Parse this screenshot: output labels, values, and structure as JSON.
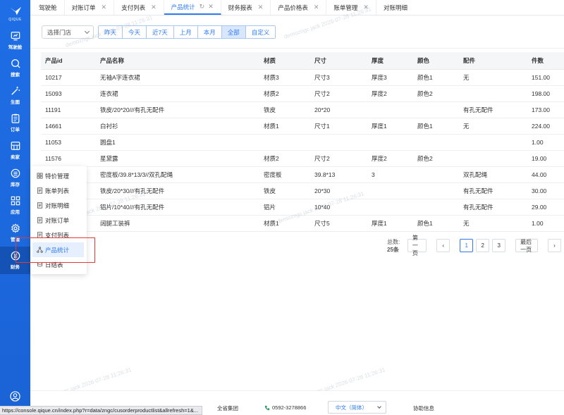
{
  "sidebar": {
    "logo_text": "QIQUE",
    "items": [
      {
        "label": "驾驶舱",
        "icon": "dashboard-icon"
      },
      {
        "label": "搜索",
        "icon": "search-icon"
      },
      {
        "label": "生图",
        "icon": "magic-wand-icon"
      },
      {
        "label": "订单",
        "icon": "order-icon"
      },
      {
        "label": "卖家",
        "icon": "seller-icon"
      },
      {
        "label": "库存",
        "icon": "inventory-icon"
      },
      {
        "label": "应用",
        "icon": "apps-icon"
      },
      {
        "label": "管理",
        "icon": "gear-icon"
      },
      {
        "label": "财务",
        "icon": "finance-icon"
      }
    ]
  },
  "tabs": [
    {
      "label": "驾驶舱",
      "closable": false
    },
    {
      "label": "对账订单",
      "closable": true
    },
    {
      "label": "支付列表",
      "closable": true
    },
    {
      "label": "产品统计",
      "closable": true,
      "active": true
    },
    {
      "label": "财务报表",
      "closable": true
    },
    {
      "label": "产品价格表",
      "closable": true
    },
    {
      "label": "账单管理",
      "closable": true
    },
    {
      "label": "对账明细",
      "closable": false
    }
  ],
  "filter": {
    "store_placeholder": "选择门店",
    "ranges": [
      "昨天",
      "今天",
      "近7天",
      "上月",
      "本月",
      "全部",
      "自定义"
    ],
    "active_range": "全部"
  },
  "table": {
    "columns": [
      "产品id",
      "产品名称",
      "材质",
      "尺寸",
      "厚度",
      "颜色",
      "配件",
      "件数"
    ],
    "rows": [
      [
        "10217",
        "无袖A字连衣裙",
        "材质3",
        "尺寸3",
        "厚度3",
        "颜色1",
        "无",
        "151.00"
      ],
      [
        "15093",
        "连衣裙",
        "材质2",
        "尺寸2",
        "厚度2",
        "颜色2",
        "",
        "198.00"
      ],
      [
        "11191",
        "铁皮/20*20///有孔无配件",
        "铁皮",
        "20*20",
        "",
        "",
        "有孔无配件",
        "173.00"
      ],
      [
        "14661",
        "白衬衫",
        "材质1",
        "尺寸1",
        "厚度1",
        "颜色1",
        "无",
        "224.00"
      ],
      [
        "11053",
        "圆盘1",
        "",
        "",
        "",
        "",
        "",
        "1.00"
      ],
      [
        "11576",
        "星黛露",
        "材质2",
        "尺寸2",
        "厚度2",
        "颜色2",
        "",
        "19.00"
      ],
      [
        "",
        "密度板/39.8*13/3//双孔配绳",
        "密度板",
        "39.8*13",
        "3",
        "",
        "双孔配绳",
        "44.00"
      ],
      [
        "",
        "铁皮/20*30///有孔无配件",
        "铁皮",
        "20*30",
        "",
        "",
        "有孔无配件",
        "30.00"
      ],
      [
        "",
        "铝片/10*40///有孔无配件",
        "铝片",
        "10*40",
        "",
        "",
        "有孔无配件",
        "29.00"
      ],
      [
        "",
        "阔腿工装裤",
        "材质1",
        "尺寸5",
        "厚度1",
        "颜色1",
        "无",
        "1.00"
      ]
    ]
  },
  "pagination": {
    "total_label": "总数:",
    "total_value": "25条",
    "first": "第一页",
    "prev": "‹",
    "pages": [
      "1",
      "2",
      "3"
    ],
    "current": "1",
    "last": "最后一页",
    "next": "›"
  },
  "popup_menu": {
    "items": [
      {
        "label": "特价管理",
        "icon": "grid-icon"
      },
      {
        "label": "账单列表",
        "icon": "document-icon"
      },
      {
        "label": "对账明细",
        "icon": "document-icon"
      },
      {
        "label": "对账订单",
        "icon": "document-icon"
      },
      {
        "label": "支付列表",
        "icon": "document-icon"
      },
      {
        "label": "产品统计",
        "icon": "network-icon",
        "active": true
      },
      {
        "label": "日结表",
        "icon": "coins-icon"
      }
    ]
  },
  "watermark": "demozngc jack 2026-07-28 11:26:31",
  "footer": {
    "group_text": "全省集团",
    "phone": "0592-3278866",
    "language": "中文（简体）",
    "help": "协助信息"
  },
  "status_url": "https://console.qique.cn/index.php?r=data/zngc/cusorderproductlist&allrefresh=1&..."
}
